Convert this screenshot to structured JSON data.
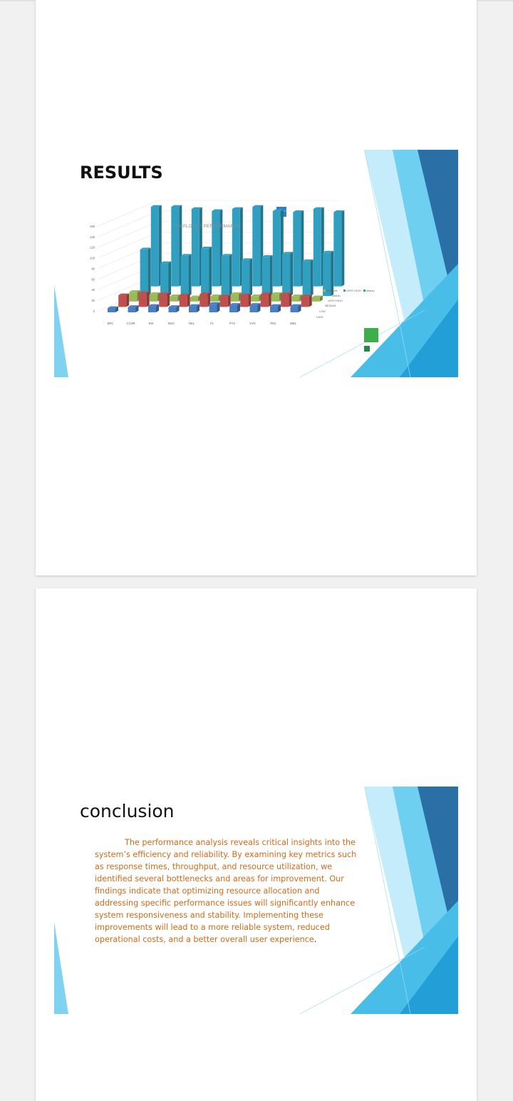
{
  "pages": [
    {
      "slide": {
        "title": "RESULTS",
        "chart_title": "EMPLOYEE PERFORMANCE"
      }
    },
    {
      "slide": {
        "title": "conclusion",
        "body": "The performance analysis reveals critical insights into the system’s efficiency and reliability. By examining key metrics such as response times, throughput, and resource utilization, we identified several bottlenecks and areas for improvement. Our findings indicate that optimizing resource allocation and addressing specific performance issues will significantly enhance system responsiveness and stability. Implementing these improvements will lead to a more reliable system, reduced operational costs, and a better overall user experience",
        "body_end": "."
      }
    }
  ],
  "colors": {
    "accent_dark": "#2f6fa8",
    "accent_light": "#4fc1ea",
    "bar_blue": "#4a7fc4",
    "bar_red": "#c0504d",
    "bar_green": "#9bbb59",
    "bar_teal": "#31a0c0",
    "text_orange": "#cf6a1a"
  },
  "chart_data": {
    "type": "bar",
    "title": "EMPLOYEE PERFORMANCE",
    "categories": [
      "BPC",
      "CCDR",
      "EW",
      "MSC",
      "NEL",
      "PL",
      "PYZ",
      "SVS",
      "TNS",
      "WBL"
    ],
    "y_ticks": [
      "0",
      "20",
      "40",
      "60",
      "80",
      "100",
      "120",
      "140",
      "160"
    ],
    "ylim": [
      0,
      160
    ],
    "depth_labels": [
      "HIGH",
      "LOW",
      "MEDIUM",
      "VERY HIGH",
      "(blank)"
    ],
    "series": [
      {
        "name": "HIGH",
        "values": [
          8,
          10,
          12,
          10,
          12,
          16,
          14,
          14,
          12,
          12
        ]
      },
      {
        "name": "LOW",
        "values": [
          22,
          26,
          24,
          22,
          24,
          20,
          22,
          24,
          24,
          20
        ]
      },
      {
        "name": "MEDIUM",
        "values": [
          18,
          14,
          10,
          8,
          10,
          14,
          10,
          14,
          10,
          8
        ]
      },
      {
        "name": "VERY HIGH",
        "values": [
          88,
          62,
          76,
          90,
          76,
          68,
          74,
          80,
          66,
          82
        ]
      },
      {
        "name": "(blank)",
        "values": [
          150,
          150,
          146,
          142,
          146,
          150,
          142,
          140,
          146,
          140
        ]
      }
    ],
    "legend": [
      "MEDIUM",
      "VERY HIGH",
      "(blank)"
    ]
  }
}
